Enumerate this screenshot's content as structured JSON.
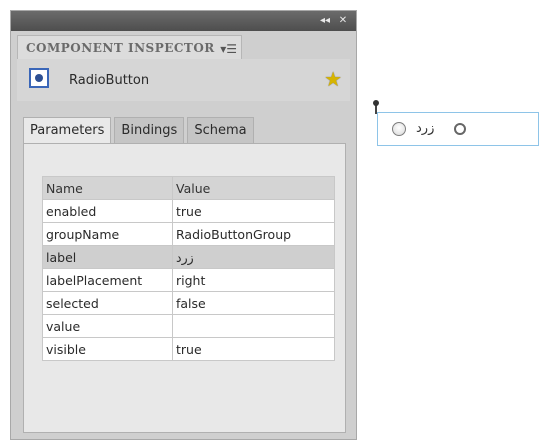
{
  "panel": {
    "title": "COMPONENT INSPECTOR",
    "chrome": {
      "collapse_glyph": "◂◂",
      "close_glyph": "✕"
    },
    "menu_glyph": "▾☰",
    "component": {
      "name": "RadioButton",
      "icon": "radio-button-component-icon",
      "star_glyph": "★"
    },
    "tabs": [
      {
        "label": "Parameters",
        "active": true
      },
      {
        "label": "Bindings",
        "active": false
      },
      {
        "label": "Schema",
        "active": false
      }
    ],
    "grid": {
      "headers": {
        "name": "Name",
        "value": "Value"
      },
      "rows": [
        {
          "name": "enabled",
          "value": "true"
        },
        {
          "name": "groupName",
          "value": "RadioButtonGroup"
        },
        {
          "name": "label",
          "value": "زرد"
        },
        {
          "name": "labelPlacement",
          "value": "right"
        },
        {
          "name": "selected",
          "value": "false"
        },
        {
          "name": "value",
          "value": ""
        },
        {
          "name": "visible",
          "value": "true"
        }
      ],
      "selected_row": "label"
    }
  },
  "stage": {
    "radio_label": "زرد"
  },
  "colors": {
    "panel_bg": "#cfcfcf",
    "chrome_bar": "#5a5a5a",
    "component_icon_border": "#3a66b8",
    "star": "#d6b400",
    "stage_border": "#8ec4e8"
  }
}
